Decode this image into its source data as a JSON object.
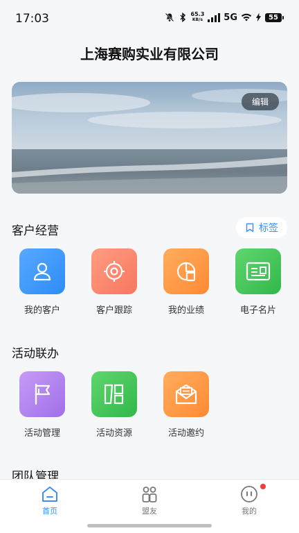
{
  "status_bar": {
    "time": "17:03",
    "net_speed_value": "65.3",
    "net_speed_unit": "KB/s",
    "network": "5G",
    "battery": "55"
  },
  "header": {
    "company_name": "上海赛购实业有限公司"
  },
  "banner": {
    "edit_label": "编辑"
  },
  "customer_section": {
    "title": "客户经营",
    "tag_label": "标签",
    "items": [
      {
        "label": "我的客户",
        "icon": "user-icon",
        "color": "#3d96f8"
      },
      {
        "label": "客户跟踪",
        "icon": "target-icon",
        "color": "#f8856b"
      },
      {
        "label": "我的业绩",
        "icon": "performance-icon",
        "color": "#ff9846"
      },
      {
        "label": "电子名片",
        "icon": "business-card-icon",
        "color": "#46c55a"
      }
    ]
  },
  "activity_section": {
    "title": "活动联办",
    "items": [
      {
        "label": "活动管理",
        "icon": "flag-icon",
        "color": "#b185f0"
      },
      {
        "label": "活动资源",
        "icon": "resource-icon",
        "color": "#46c55a"
      },
      {
        "label": "活动邀约",
        "icon": "invitation-icon",
        "color": "#ff9846"
      }
    ]
  },
  "team_section": {
    "title": "团队管理"
  },
  "bottom_nav": {
    "items": [
      {
        "label": "首页",
        "icon": "home-icon",
        "active": true
      },
      {
        "label": "盟友",
        "icon": "allies-icon",
        "active": false
      },
      {
        "label": "我的",
        "icon": "profile-icon",
        "active": false,
        "badge": true
      }
    ]
  },
  "colors": {
    "accent": "#3a8ef6",
    "badge": "#f23c3c"
  }
}
